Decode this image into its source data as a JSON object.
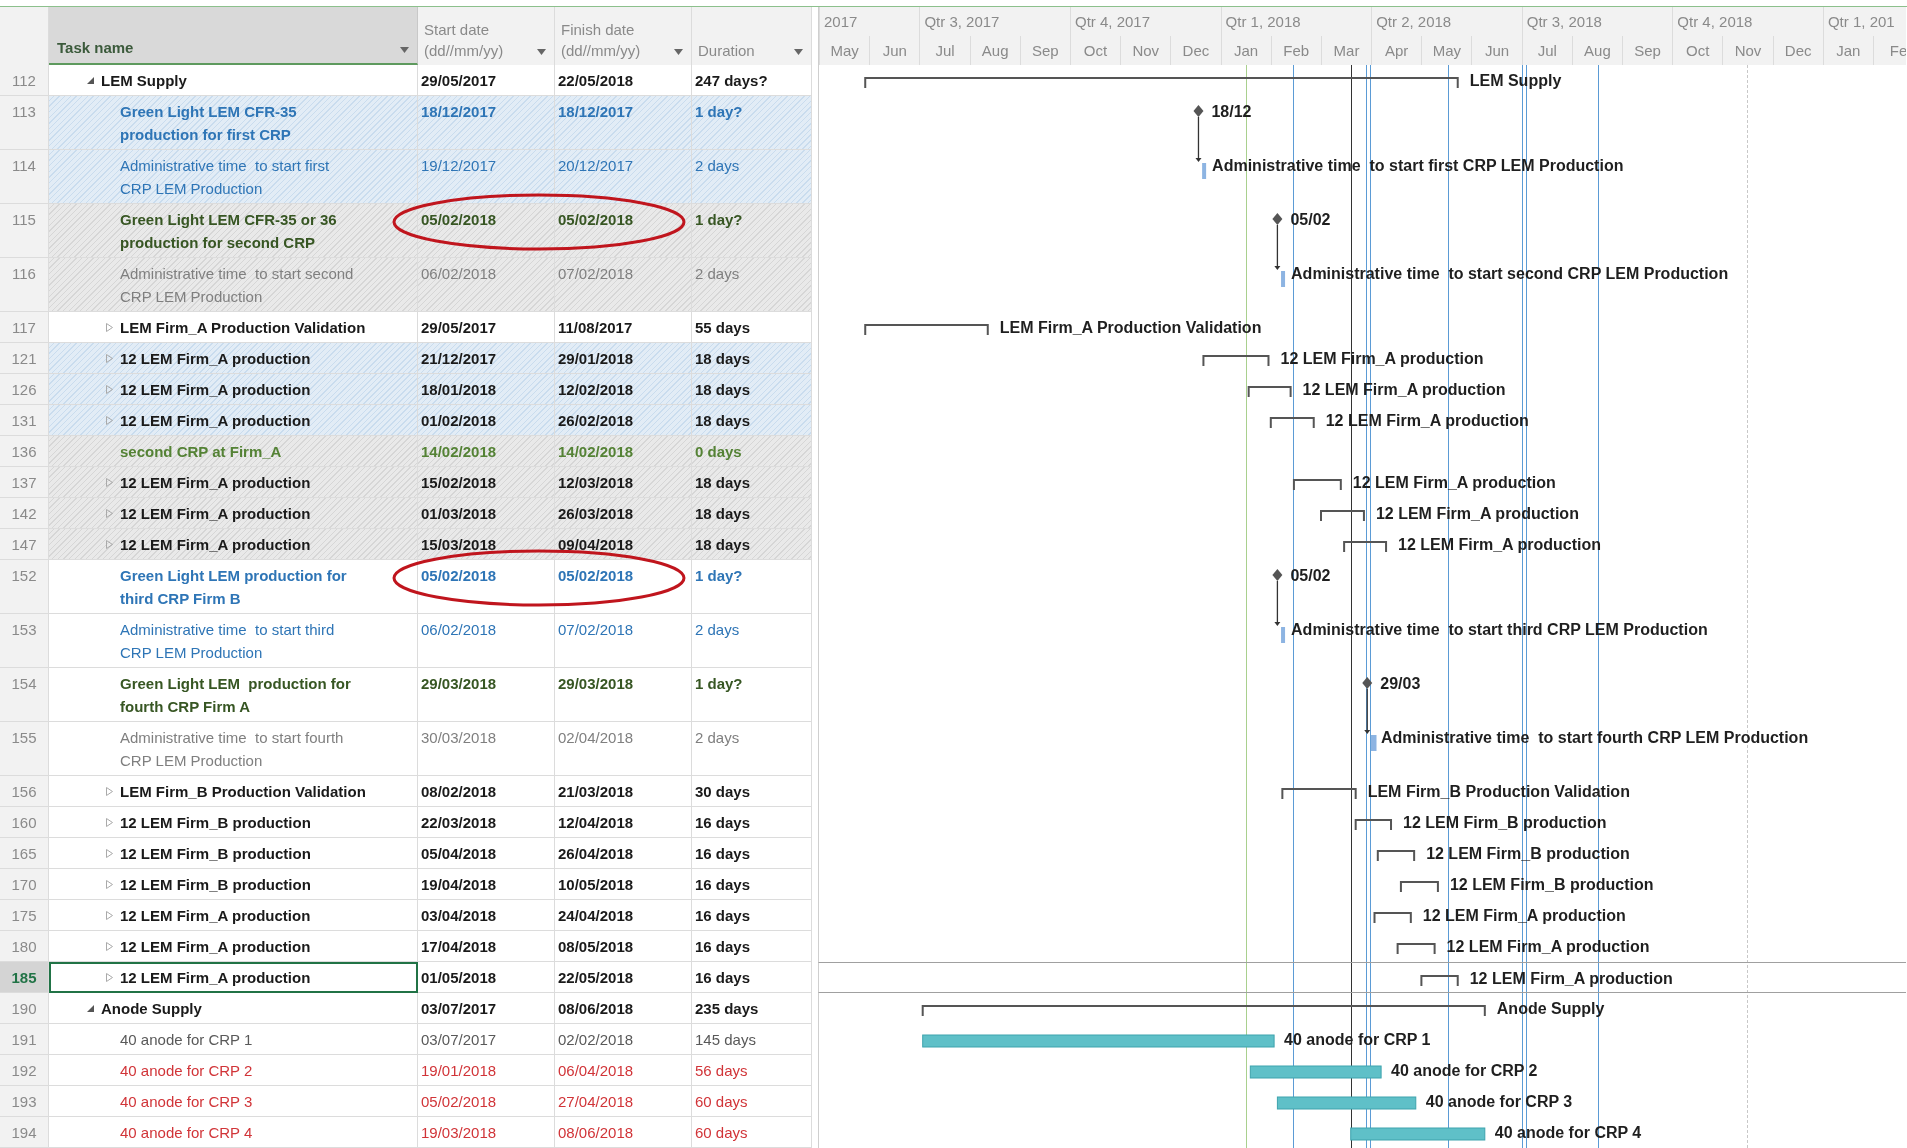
{
  "columns": [
    {
      "label": "Task name"
    },
    {
      "label": "Start date\n(dd//mm/yy)"
    },
    {
      "label": "Finish date\n(dd//mm/yy)"
    },
    {
      "label": "Duration"
    }
  ],
  "timescale": {
    "quarters": [
      "2017",
      "Qtr 3, 2017",
      "Qtr 4, 2017",
      "Qtr 1, 2018",
      "Qtr 2, 2018",
      "Qtr 3, 2018",
      "Qtr 4, 2018",
      "Qtr 1, 201"
    ],
    "months": [
      "May",
      "Jun",
      "Jul",
      "Aug",
      "Sep",
      "Oct",
      "Nov",
      "Dec",
      "Jan",
      "Feb",
      "Mar",
      "Apr",
      "May",
      "Jun",
      "Jul",
      "Aug",
      "Sep",
      "Oct",
      "Nov",
      "Dec",
      "Jan",
      "Fe"
    ]
  },
  "rows": [
    {
      "id": "112",
      "name": "LEM Supply",
      "start": "29/05/2017",
      "finish": "22/05/2018",
      "duration": "247 days?",
      "kind": "summary",
      "expanded": true,
      "color": "#1a1a1a",
      "bold": true,
      "selected": false,
      "circled": false,
      "bar": {
        "kind": "summary",
        "label": "LEM Supply"
      },
      "children": [
        {
          "id": "113",
          "name": "Green Light LEM CFR-35\nproduction for first CRP",
          "start": "18/12/2017",
          "finish": "18/12/2017",
          "duration": "1 day?",
          "kind": "task",
          "expanded": false,
          "color": "#2e75b6",
          "bold": true,
          "highlight": {
            "color": "#c9dcee"
          },
          "selected": false,
          "circled": false,
          "bar": {
            "kind": "milestone",
            "label": "18/12"
          }
        },
        {
          "id": "114",
          "name": "Administrative time  to start first\nCRP LEM Production",
          "start": "19/12/2017",
          "finish": "20/12/2017",
          "duration": "2 days",
          "kind": "task",
          "expanded": false,
          "color": "#2e75b6",
          "bold": false,
          "highlight": {
            "color": "#c9dcee"
          },
          "selected": false,
          "circled": false,
          "bar": {
            "kind": "task",
            "label": "Administrative time  to start first CRP LEM Production"
          }
        },
        {
          "id": "115",
          "name": "Green Light LEM CFR-35 or 36\nproduction for second CRP",
          "start": "05/02/2018",
          "finish": "05/02/2018",
          "duration": "1 day?",
          "kind": "task",
          "expanded": false,
          "color": "#375623",
          "bold": true,
          "highlight": {
            "color": "#d6d6d6"
          },
          "selected": false,
          "circled": true,
          "bar": {
            "kind": "milestone",
            "label": "05/02"
          }
        },
        {
          "id": "116",
          "name": "Administrative time  to start second\nCRP LEM Production",
          "start": "06/02/2018",
          "finish": "07/02/2018",
          "duration": "2 days",
          "kind": "task",
          "expanded": false,
          "color": "#7f7f7f",
          "bold": false,
          "highlight": {
            "color": "#d6d6d6"
          },
          "selected": false,
          "circled": false,
          "bar": {
            "kind": "task",
            "label": "Administrative time  to start second CRP LEM Production"
          }
        },
        {
          "id": "117",
          "name": "LEM Firm_A Production Validation",
          "start": "29/05/2017",
          "finish": "11/08/2017",
          "duration": "55 days",
          "kind": "summary",
          "expanded": false,
          "color": "#1a1a1a",
          "bold": true,
          "selected": false,
          "circled": false,
          "bar": {
            "kind": "summary",
            "label": "LEM Firm_A Production Validation"
          }
        },
        {
          "id": "121",
          "name": "12 LEM Firm_A production",
          "start": "21/12/2017",
          "finish": "29/01/2018",
          "duration": "18 days",
          "kind": "summary",
          "expanded": false,
          "color": "#1a1a1a",
          "bold": true,
          "highlight": {
            "color": "#c9dcee"
          },
          "selected": false,
          "circled": false,
          "bar": {
            "kind": "summary",
            "label": "12 LEM Firm_A production"
          }
        },
        {
          "id": "126",
          "name": "12 LEM Firm_A production",
          "start": "18/01/2018",
          "finish": "12/02/2018",
          "duration": "18 days",
          "kind": "summary",
          "expanded": false,
          "color": "#1a1a1a",
          "bold": true,
          "highlight": {
            "color": "#c9dcee"
          },
          "selected": false,
          "circled": false,
          "bar": {
            "kind": "summary",
            "label": "12 LEM Firm_A production"
          }
        },
        {
          "id": "131",
          "name": "12 LEM Firm_A production",
          "start": "01/02/2018",
          "finish": "26/02/2018",
          "duration": "18 days",
          "kind": "summary",
          "expanded": false,
          "color": "#1a1a1a",
          "bold": true,
          "highlight": {
            "color": "#c9dcee"
          },
          "selected": false,
          "circled": false,
          "bar": {
            "kind": "summary",
            "label": "12 LEM Firm_A production"
          }
        },
        {
          "id": "136",
          "name": "second CRP at Firm_A",
          "start": "14/02/2018",
          "finish": "14/02/2018",
          "duration": "0 days",
          "kind": "task",
          "expanded": false,
          "color": "#548235",
          "bold": true,
          "highlight": {
            "color": "#d6d6d6"
          },
          "selected": false,
          "circled": false,
          "bar": {
            "kind": "none"
          }
        },
        {
          "id": "137",
          "name": "12 LEM Firm_A production",
          "start": "15/02/2018",
          "finish": "12/03/2018",
          "duration": "18 days",
          "kind": "summary",
          "expanded": false,
          "color": "#1a1a1a",
          "bold": true,
          "highlight": {
            "color": "#d6d6d6"
          },
          "selected": false,
          "circled": false,
          "bar": {
            "kind": "summary",
            "label": "12 LEM Firm_A production"
          }
        },
        {
          "id": "142",
          "name": "12 LEM Firm_A production",
          "start": "01/03/2018",
          "finish": "26/03/2018",
          "duration": "18 days",
          "kind": "summary",
          "expanded": false,
          "color": "#1a1a1a",
          "bold": true,
          "highlight": {
            "color": "#d6d6d6"
          },
          "selected": false,
          "circled": false,
          "bar": {
            "kind": "summary",
            "label": "12 LEM Firm_A production"
          }
        },
        {
          "id": "147",
          "name": "12 LEM Firm_A production",
          "start": "15/03/2018",
          "finish": "09/04/2018",
          "duration": "18 days",
          "kind": "summary",
          "expanded": false,
          "color": "#1a1a1a",
          "bold": true,
          "highlight": {
            "color": "#d6d6d6"
          },
          "selected": false,
          "circled": false,
          "bar": {
            "kind": "summary",
            "label": "12 LEM Firm_A production"
          }
        },
        {
          "id": "152",
          "name": "Green Light LEM production for\nthird CRP Firm B",
          "start": "05/02/2018",
          "finish": "05/02/2018",
          "duration": "1 day?",
          "kind": "task",
          "expanded": false,
          "color": "#2e75b6",
          "bold": true,
          "selected": false,
          "circled": true,
          "bar": {
            "kind": "milestone",
            "label": "05/02"
          }
        },
        {
          "id": "153",
          "name": "Administrative time  to start third\nCRP LEM Production",
          "start": "06/02/2018",
          "finish": "07/02/2018",
          "duration": "2 days",
          "kind": "task",
          "expanded": false,
          "color": "#2e75b6",
          "bold": false,
          "selected": false,
          "circled": false,
          "bar": {
            "kind": "task",
            "label": "Administrative time  to start third CRP LEM Production"
          }
        },
        {
          "id": "154",
          "name": "Green Light LEM  production for\nfourth CRP Firm A",
          "start": "29/03/2018",
          "finish": "29/03/2018",
          "duration": "1 day?",
          "kind": "task",
          "expanded": false,
          "color": "#375623",
          "bold": true,
          "selected": false,
          "circled": false,
          "bar": {
            "kind": "milestone",
            "label": "29/03"
          }
        },
        {
          "id": "155",
          "name": "Administrative time  to start fourth\nCRP LEM Production",
          "start": "30/03/2018",
          "finish": "02/04/2018",
          "duration": "2 days",
          "kind": "task",
          "expanded": false,
          "color": "#7f7f7f",
          "bold": false,
          "selected": false,
          "circled": false,
          "bar": {
            "kind": "task",
            "label": "Administrative time  to start fourth CRP LEM Production"
          }
        },
        {
          "id": "156",
          "name": "LEM Firm_B Production Validation",
          "start": "08/02/2018",
          "finish": "21/03/2018",
          "duration": "30 days",
          "kind": "summary",
          "expanded": false,
          "color": "#1a1a1a",
          "bold": true,
          "selected": false,
          "circled": false,
          "bar": {
            "kind": "summary",
            "label": "LEM Firm_B Production Validation"
          }
        },
        {
          "id": "160",
          "name": "12 LEM Firm_B production",
          "start": "22/03/2018",
          "finish": "12/04/2018",
          "duration": "16 days",
          "kind": "summary",
          "expanded": false,
          "color": "#1a1a1a",
          "bold": true,
          "selected": false,
          "circled": false,
          "bar": {
            "kind": "summary",
            "label": "12 LEM Firm_B production"
          }
        },
        {
          "id": "165",
          "name": "12 LEM Firm_B production",
          "start": "05/04/2018",
          "finish": "26/04/2018",
          "duration": "16 days",
          "kind": "summary",
          "expanded": false,
          "color": "#1a1a1a",
          "bold": true,
          "selected": false,
          "circled": false,
          "bar": {
            "kind": "summary",
            "label": "12 LEM Firm_B production"
          }
        },
        {
          "id": "170",
          "name": "12 LEM Firm_B production",
          "start": "19/04/2018",
          "finish": "10/05/2018",
          "duration": "16 days",
          "kind": "summary",
          "expanded": false,
          "color": "#1a1a1a",
          "bold": true,
          "selected": false,
          "circled": false,
          "bar": {
            "kind": "summary",
            "label": "12 LEM Firm_B production"
          }
        },
        {
          "id": "175",
          "name": "12 LEM Firm_A production",
          "start": "03/04/2018",
          "finish": "24/04/2018",
          "duration": "16 days",
          "kind": "summary",
          "expanded": false,
          "color": "#1a1a1a",
          "bold": true,
          "selected": false,
          "circled": false,
          "bar": {
            "kind": "summary",
            "label": "12 LEM Firm_A production"
          }
        },
        {
          "id": "180",
          "name": "12 LEM Firm_A production",
          "start": "17/04/2018",
          "finish": "08/05/2018",
          "duration": "16 days",
          "kind": "summary",
          "expanded": false,
          "color": "#1a1a1a",
          "bold": true,
          "selected": false,
          "circled": false,
          "bar": {
            "kind": "summary",
            "label": "12 LEM Firm_A production"
          }
        },
        {
          "id": "185",
          "name": "12 LEM Firm_A production",
          "start": "01/05/2018",
          "finish": "22/05/2018",
          "duration": "16 days",
          "kind": "summary",
          "expanded": false,
          "color": "#1a1a1a",
          "bold": true,
          "selected": true,
          "circled": false,
          "bar": {
            "kind": "summary",
            "label": "12 LEM Firm_A production"
          }
        }
      ]
    },
    {
      "id": "190",
      "name": "Anode Supply",
      "start": "03/07/2017",
      "finish": "08/06/2018",
      "duration": "235 days",
      "kind": "summary",
      "expanded": true,
      "color": "#1a1a1a",
      "bold": true,
      "selected": false,
      "circled": false,
      "bar": {
        "kind": "summary",
        "label": "Anode Supply"
      },
      "children": [
        {
          "id": "191",
          "name": "40 anode for CRP 1",
          "start": "03/07/2017",
          "finish": "02/02/2018",
          "duration": "145 days",
          "kind": "task",
          "expanded": false,
          "color": "#595959",
          "bold": false,
          "selected": false,
          "circled": false,
          "bar": {
            "kind": "bar",
            "label": "40 anode for CRP 1"
          }
        },
        {
          "id": "192",
          "name": "40 anode for CRP 2",
          "start": "19/01/2018",
          "finish": "06/04/2018",
          "duration": "56 days",
          "kind": "task",
          "expanded": false,
          "color": "#d13438",
          "bold": false,
          "selected": false,
          "circled": false,
          "bar": {
            "kind": "bar",
            "label": "40 anode for CRP 2"
          }
        },
        {
          "id": "193",
          "name": "40 anode for CRP 3",
          "start": "05/02/2018",
          "finish": "27/04/2018",
          "duration": "60 days",
          "kind": "task",
          "expanded": false,
          "color": "#d13438",
          "bold": false,
          "selected": false,
          "circled": false,
          "bar": {
            "kind": "bar",
            "label": "40 anode for CRP 3"
          }
        },
        {
          "id": "194",
          "name": "40 anode for CRP 4",
          "start": "19/03/2018",
          "finish": "08/06/2018",
          "duration": "60 days",
          "kind": "task",
          "expanded": false,
          "color": "#d13438",
          "bold": false,
          "selected": false,
          "circled": false,
          "bar": {
            "kind": "bar",
            "label": "40 anode for CRP 4"
          }
        }
      ]
    }
  ]
}
